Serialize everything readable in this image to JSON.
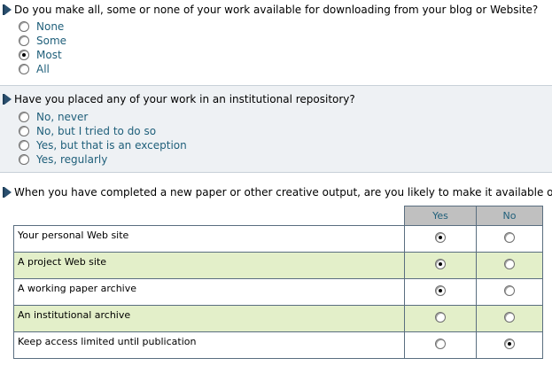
{
  "q1": {
    "text": "Do you make all, some or none of your work available for downloading from your blog or Website?",
    "options": [
      {
        "label": "None",
        "checked": false
      },
      {
        "label": "Some",
        "checked": false
      },
      {
        "label": "Most",
        "checked": true
      },
      {
        "label": "All",
        "checked": false
      }
    ]
  },
  "q2": {
    "text": "Have you placed any of your work in an institutional repository?",
    "options": [
      {
        "label": "No, never",
        "checked": false
      },
      {
        "label": "No, but I tried to do so",
        "checked": false
      },
      {
        "label": "Yes, but that is an exception",
        "checked": false
      },
      {
        "label": "Yes, regularly",
        "checked": false
      }
    ]
  },
  "q3": {
    "text": "When you have completed a new paper or other creative output, are you likely to make it available on:",
    "columns": [
      "Yes",
      "No"
    ],
    "rows": [
      {
        "label": "Your personal Web site",
        "selected": "Yes"
      },
      {
        "label": "A project Web site",
        "selected": "Yes"
      },
      {
        "label": "A working paper archive",
        "selected": "Yes"
      },
      {
        "label": "An institutional archive",
        "selected": ""
      },
      {
        "label": "Keep access limited until publication",
        "selected": "No"
      }
    ]
  },
  "colors": {
    "accent_text": "#1f5f7a",
    "alt_row": "#e3efc9",
    "section_alt_bg": "#eef1f4",
    "header_bg": "#c0c0c0"
  }
}
